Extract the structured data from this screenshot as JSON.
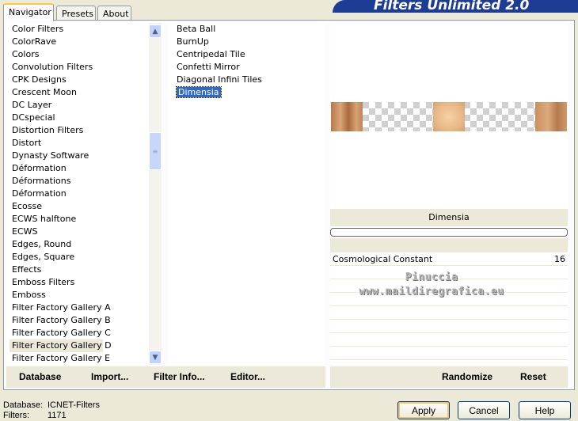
{
  "tabs": [
    "Navigator",
    "Presets",
    "About"
  ],
  "banner": "Filters Unlimited 2.0",
  "categories": [
    "Color Filters",
    "ColorRave",
    "Colors",
    "Convolution Filters",
    "CPK Designs",
    "Crescent Moon",
    "DC Layer",
    "DCspecial",
    "Distortion Filters",
    "Distort",
    "Dynasty Software",
    "Déformation",
    "Déformations",
    "Déformation",
    "Ecosse",
    "ECWS halftone",
    "ECWS",
    "Edges, Round",
    "Edges, Square",
    "Effects",
    "Emboss Filters",
    "Emboss",
    "Filter Factory Gallery A",
    "Filter Factory Gallery B",
    "Filter Factory Gallery C",
    "Filter Factory Gallery D",
    "Filter Factory Gallery E"
  ],
  "selected_category_index": 25,
  "filters": [
    "Beta Ball",
    "BurnUp",
    "Centripedal Tile",
    "Confetti Mirror",
    "Diagonal Infini Tiles",
    "Dimensia"
  ],
  "selected_filter_index": 5,
  "preview": {
    "filter_name": "Dimensia",
    "progress": 0
  },
  "params": [
    {
      "name": "Cosmological Constant",
      "value": "16"
    }
  ],
  "watermark": [
    "Pinuccia",
    "www.maildiregrafica.eu"
  ],
  "left_buttons": {
    "database": "Database",
    "import": "Import...",
    "filter_info": "Filter Info...",
    "editor": "Editor..."
  },
  "right_buttons": {
    "randomize": "Randomize",
    "reset": "Reset"
  },
  "status": {
    "database_label": "Database:",
    "database_value": "ICNET-Filters",
    "filters_label": "Filters:",
    "filters_value": "1171"
  },
  "dialog_buttons": {
    "apply": "Apply",
    "cancel": "Cancel",
    "help": "Help"
  },
  "colors": {
    "selection": "#316ac5",
    "banner": "#1d3d94",
    "face": "#ece9d8"
  }
}
